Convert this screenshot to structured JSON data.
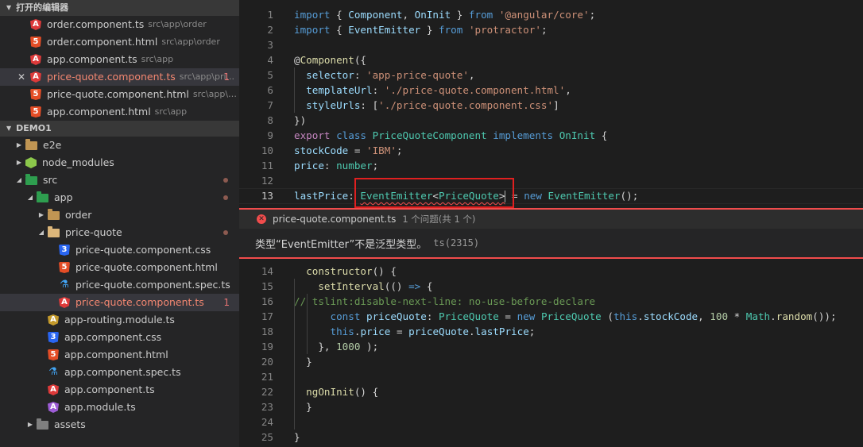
{
  "explorer": {
    "open_editors_title": "打开的编辑器",
    "open_editors": [
      {
        "icon": "angular-icon",
        "name": "order.component.ts",
        "desc": "src\\app\\order",
        "badge": "",
        "selected": false,
        "close": false
      },
      {
        "icon": "html-icon",
        "name": "order.component.html",
        "desc": "src\\app\\order",
        "badge": "",
        "selected": false,
        "close": false
      },
      {
        "icon": "angular-icon",
        "name": "app.component.ts",
        "desc": "src\\app",
        "badge": "",
        "selected": false,
        "close": false
      },
      {
        "icon": "angular-icon",
        "name": "price-quote.component.ts",
        "desc": "src\\app\\pri...",
        "badge": "1",
        "selected": true,
        "close": true
      },
      {
        "icon": "html-icon",
        "name": "price-quote.component.html",
        "desc": "src\\app\\pric...",
        "badge": "",
        "selected": false,
        "close": false
      },
      {
        "icon": "html-icon",
        "name": "app.component.html",
        "desc": "src\\app",
        "badge": "",
        "selected": false,
        "close": false
      }
    ],
    "project_title": "DEMO1",
    "tree": [
      {
        "name": "e2e",
        "icon": "folder-icon",
        "twist": "closed",
        "level": 0
      },
      {
        "name": "node_modules",
        "icon": "node-icon",
        "twist": "closed",
        "level": 0
      },
      {
        "name": "src",
        "icon": "folder-src-icon",
        "twist": "open",
        "level": 0,
        "dot": true
      },
      {
        "name": "app",
        "icon": "folder-app-icon",
        "twist": "open",
        "level": 1,
        "dot": true
      },
      {
        "name": "order",
        "icon": "folder-icon",
        "twist": "closed",
        "level": 2
      },
      {
        "name": "price-quote",
        "icon": "folder-open-icon",
        "twist": "open",
        "level": 2,
        "dot": true
      },
      {
        "name": "price-quote.component.css",
        "icon": "css-icon",
        "level": 3
      },
      {
        "name": "price-quote.component.html",
        "icon": "html-icon",
        "level": 3
      },
      {
        "name": "price-quote.component.spec.ts",
        "icon": "spec-icon",
        "level": 3
      },
      {
        "name": "price-quote.component.ts",
        "icon": "angular-icon",
        "level": 3,
        "badge": "1",
        "selected": true
      },
      {
        "name": "app-routing.module.ts",
        "icon": "routing-icon",
        "level": 2
      },
      {
        "name": "app.component.css",
        "icon": "css-icon",
        "level": 2
      },
      {
        "name": "app.component.html",
        "icon": "html-icon",
        "level": 2
      },
      {
        "name": "app.component.spec.ts",
        "icon": "spec-icon",
        "level": 2
      },
      {
        "name": "app.component.ts",
        "icon": "angular-icon",
        "level": 2
      },
      {
        "name": "app.module.ts",
        "icon": "angular-module-icon",
        "level": 2
      },
      {
        "name": "assets",
        "icon": "folder-assets-icon",
        "twist": "closed",
        "level": 1
      }
    ]
  },
  "editor": {
    "lines_top": [
      {
        "n": "1",
        "t": [
          [
            "k",
            "import"
          ],
          [
            "p",
            " { "
          ],
          [
            "v",
            "Component"
          ],
          [
            "p",
            ", "
          ],
          [
            "v",
            "OnInit"
          ],
          [
            "p",
            " } "
          ],
          [
            "k",
            "from"
          ],
          [
            "p",
            " "
          ],
          [
            "s",
            "'@angular/core'"
          ],
          [
            "p",
            ";"
          ]
        ]
      },
      {
        "n": "2",
        "t": [
          [
            "k",
            "import"
          ],
          [
            "p",
            " { "
          ],
          [
            "v",
            "EventEmitter"
          ],
          [
            "p",
            " } "
          ],
          [
            "k",
            "from"
          ],
          [
            "p",
            " "
          ],
          [
            "s",
            "'protractor'"
          ],
          [
            "p",
            ";"
          ]
        ]
      },
      {
        "n": "3",
        "t": []
      },
      {
        "n": "4",
        "t": [
          [
            "p",
            "@"
          ],
          [
            "f",
            "Component"
          ],
          [
            "p",
            "({"
          ]
        ]
      },
      {
        "n": "5",
        "t": [
          [
            "p",
            "  "
          ],
          [
            "v",
            "selector"
          ],
          [
            "p",
            ": "
          ],
          [
            "s",
            "'app-price-quote'"
          ],
          [
            "p",
            ","
          ]
        ]
      },
      {
        "n": "6",
        "t": [
          [
            "p",
            "  "
          ],
          [
            "v",
            "templateUrl"
          ],
          [
            "p",
            ": "
          ],
          [
            "s",
            "'./price-quote.component.html'"
          ],
          [
            "p",
            ","
          ]
        ]
      },
      {
        "n": "7",
        "t": [
          [
            "p",
            "  "
          ],
          [
            "v",
            "styleUrls"
          ],
          [
            "p",
            ": ["
          ],
          [
            "s",
            "'./price-quote.component.css'"
          ],
          [
            "p",
            "]"
          ]
        ]
      },
      {
        "n": "8",
        "t": [
          [
            "p",
            "})"
          ]
        ]
      },
      {
        "n": "9",
        "t": [
          [
            "c",
            "export"
          ],
          [
            "p",
            " "
          ],
          [
            "k",
            "class"
          ],
          [
            "p",
            " "
          ],
          [
            "t",
            "PriceQuoteComponent"
          ],
          [
            "p",
            " "
          ],
          [
            "k",
            "implements"
          ],
          [
            "p",
            " "
          ],
          [
            "t",
            "OnInit"
          ],
          [
            "p",
            " {"
          ]
        ]
      },
      {
        "n": "10",
        "t": [
          [
            "v",
            "stockCode"
          ],
          [
            "p",
            " = "
          ],
          [
            "s",
            "'IBM'"
          ],
          [
            "p",
            ";"
          ]
        ]
      },
      {
        "n": "11",
        "t": [
          [
            "v",
            "price"
          ],
          [
            "p",
            ": "
          ],
          [
            "t",
            "number"
          ],
          [
            "p",
            ";"
          ]
        ]
      },
      {
        "n": "12",
        "t": []
      },
      {
        "n": "13",
        "cur": true,
        "t": [
          [
            "v",
            "lastPrice"
          ],
          [
            "p",
            ": "
          ],
          [
            "t squig",
            "EventEmitter"
          ],
          [
            "p squig",
            "<"
          ],
          [
            "t squig",
            "PriceQuote"
          ],
          [
            "p squig",
            ">"
          ],
          [
            "caret",
            ""
          ],
          [
            "p",
            " = "
          ],
          [
            "k",
            "new"
          ],
          [
            "p",
            " "
          ],
          [
            "t",
            "EventEmitter"
          ],
          [
            "p",
            "();"
          ]
        ]
      }
    ],
    "lines_bottom": [
      {
        "n": "14",
        "t": [
          [
            "p",
            "  "
          ],
          [
            "f",
            "constructor"
          ],
          [
            "p",
            "() {"
          ]
        ]
      },
      {
        "n": "15",
        "t": [
          [
            "p",
            "    "
          ],
          [
            "f",
            "setInterval"
          ],
          [
            "p",
            "(() "
          ],
          [
            "k",
            "=>"
          ],
          [
            "p",
            " {"
          ]
        ]
      },
      {
        "n": "16",
        "t": [
          [
            "cm",
            "// tslint:disable-next-line: no-use-before-declare"
          ]
        ]
      },
      {
        "n": "17",
        "t": [
          [
            "p",
            "      "
          ],
          [
            "k",
            "const"
          ],
          [
            "p",
            " "
          ],
          [
            "v",
            "priceQuote"
          ],
          [
            "p",
            ": "
          ],
          [
            "t",
            "PriceQuote"
          ],
          [
            "p",
            " = "
          ],
          [
            "k",
            "new"
          ],
          [
            "p",
            " "
          ],
          [
            "t",
            "PriceQuote"
          ],
          [
            "p",
            " ("
          ],
          [
            "k",
            "this"
          ],
          [
            "p",
            "."
          ],
          [
            "v",
            "stockCode"
          ],
          [
            "p",
            ", "
          ],
          [
            "n",
            "100"
          ],
          [
            "p",
            " * "
          ],
          [
            "t",
            "Math"
          ],
          [
            "p",
            "."
          ],
          [
            "f",
            "random"
          ],
          [
            "p",
            "());"
          ]
        ]
      },
      {
        "n": "18",
        "t": [
          [
            "p",
            "      "
          ],
          [
            "k",
            "this"
          ],
          [
            "p",
            "."
          ],
          [
            "v",
            "price"
          ],
          [
            "p",
            " = "
          ],
          [
            "v",
            "priceQuote"
          ],
          [
            "p",
            "."
          ],
          [
            "v",
            "lastPrice"
          ],
          [
            "p",
            ";"
          ]
        ]
      },
      {
        "n": "19",
        "t": [
          [
            "p",
            "    }, "
          ],
          [
            "n",
            "1000"
          ],
          [
            "p",
            " );"
          ]
        ]
      },
      {
        "n": "20",
        "t": [
          [
            "p",
            "  }"
          ]
        ]
      },
      {
        "n": "21",
        "t": []
      },
      {
        "n": "22",
        "t": [
          [
            "p",
            "  "
          ],
          [
            "f",
            "ngOnInit"
          ],
          [
            "p",
            "() {"
          ]
        ]
      },
      {
        "n": "23",
        "t": [
          [
            "p",
            "  }"
          ]
        ]
      },
      {
        "n": "24",
        "t": []
      },
      {
        "n": "25",
        "t": [
          [
            "p",
            "}"
          ]
        ]
      }
    ],
    "peek": {
      "file": "price-quote.component.ts",
      "count": "1 个问题(共 1 个)",
      "message": "类型“EventEmitter”不是泛型类型。",
      "code": "ts(2315)"
    }
  }
}
